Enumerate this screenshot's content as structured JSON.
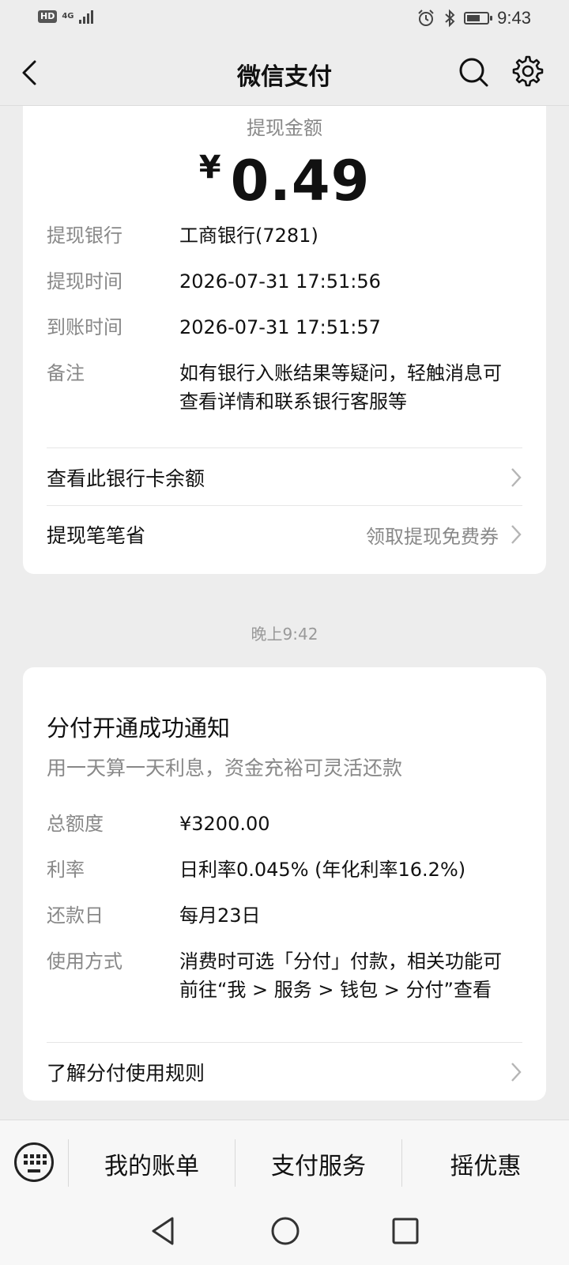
{
  "status_bar": {
    "hd": "HD",
    "network": "4G",
    "time": "9:43",
    "icons": [
      "alarm-icon",
      "bluetooth-icon",
      "battery-icon"
    ]
  },
  "nav": {
    "title": "微信支付",
    "icons": [
      "back-icon",
      "search-icon",
      "gear-icon"
    ]
  },
  "withdrawal": {
    "amount_label": "提现金额",
    "currency": "¥",
    "amount": "0.49",
    "fields": [
      {
        "key": "提现银行",
        "value": "工商银行(7281)"
      },
      {
        "key": "提现时间",
        "value": "2026-07-31 17:51:56"
      },
      {
        "key": "到账时间",
        "value": "2026-07-31 17:51:57"
      },
      {
        "key": "备注",
        "value_line1": "如有银行入账结果等疑问，轻触消息可",
        "value_line2": "查看详情和联系银行客服等"
      }
    ],
    "links": [
      {
        "label": "查看此银行卡余额",
        "right": ""
      },
      {
        "label": "提现笔笔省",
        "right": "领取提现免费券"
      }
    ]
  },
  "timestamp": "晚上9:42",
  "credit_notice": {
    "title": "分付开通成功通知",
    "subtitle": "用一天算一天利息，资金充裕可灵活还款",
    "fields": [
      {
        "key": "总额度",
        "value": "¥3200.00"
      },
      {
        "key": "利率",
        "value": "日利率0.045% (年化利率16.2%)"
      },
      {
        "key": "还款日",
        "value": "每月23日"
      },
      {
        "key": "使用方式",
        "value_line1": "消费时可选「分付」付款，相关功能可",
        "value_line2": "前往“我 > 服务 > 钱包 > 分付”查看"
      }
    ],
    "link": "了解分付使用规则"
  },
  "bottom_menu": {
    "items": [
      "我的账单",
      "支付服务",
      "摇优惠"
    ],
    "keyboard_icon": "keyboard-icon"
  },
  "system_nav": [
    "back-triangle-icon",
    "home-circle-icon",
    "recents-square-icon"
  ]
}
